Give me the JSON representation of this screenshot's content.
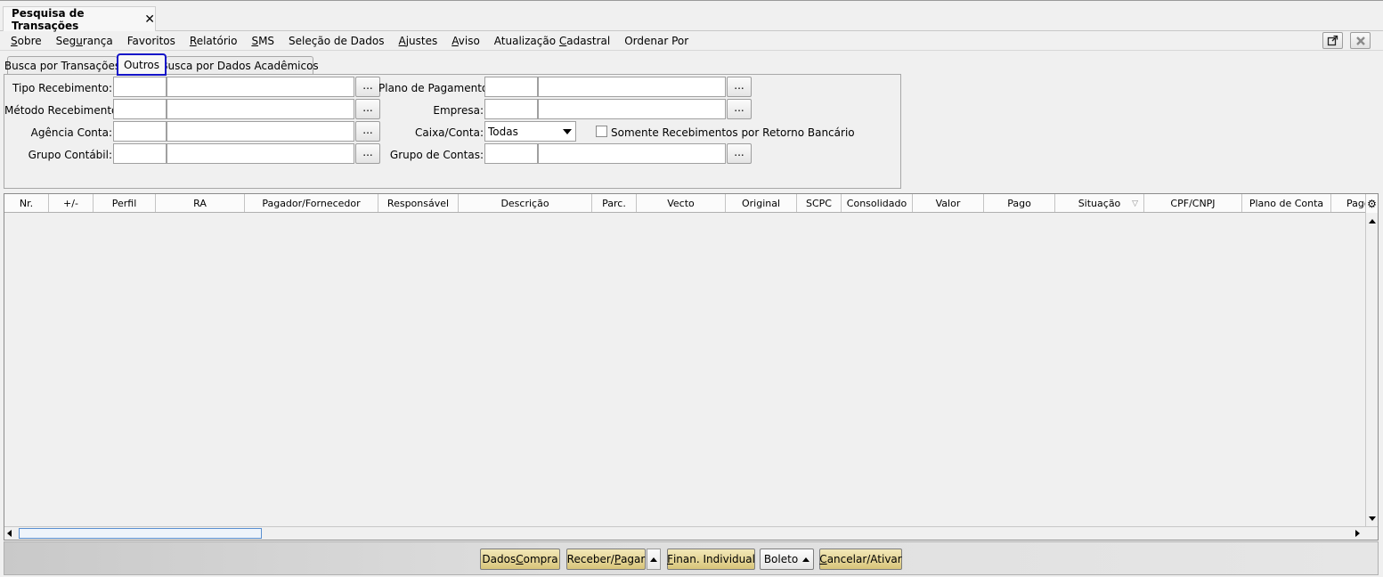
{
  "window_tab": {
    "title": "Pesquisa de Transações",
    "close": "✕"
  },
  "menu": [
    {
      "pre": "",
      "ul": "S",
      "post": "obre"
    },
    {
      "pre": "Seg",
      "ul": "u",
      "post": "rança"
    },
    {
      "pre": "Favoritos",
      "ul": "",
      "post": ""
    },
    {
      "pre": "",
      "ul": "R",
      "post": "elatório"
    },
    {
      "pre": "",
      "ul": "S",
      "post": "MS"
    },
    {
      "pre": "Seleção de Dados",
      "ul": "",
      "post": ""
    },
    {
      "pre": "",
      "ul": "A",
      "post": "justes"
    },
    {
      "pre": "",
      "ul": "A",
      "post": "viso"
    },
    {
      "pre": "Atualização ",
      "ul": "C",
      "post": "adastral"
    },
    {
      "pre": "Ordenar Por",
      "ul": "",
      "post": ""
    }
  ],
  "tabs": [
    {
      "label": "Busca por Transações"
    },
    {
      "label": "Outros"
    },
    {
      "label": "Busca por Dados Acadêmicos"
    }
  ],
  "filters": {
    "tipo_recebimento": "Tipo Recebimento:",
    "metodo_recebimento": "Método Recebimento:",
    "agencia_conta": "Agência Conta:",
    "grupo_contabil": "Grupo Contábil:",
    "plano_pagamento": "Plano de Pagamento:",
    "empresa": "Empresa:",
    "caixa_conta": "Caixa/Conta:",
    "caixa_conta_value": "Todas",
    "grupo_contas": "Grupo de Contas:",
    "somente_retorno": "Somente Recebimentos por Retorno Bancário",
    "lookup_button": "..."
  },
  "grid": {
    "columns": [
      "Nr.",
      "+/-",
      "Perfil",
      "RA",
      "Pagador/Fornecedor",
      "Responsável",
      "Descrição",
      "Parc.",
      "Vecto",
      "Original",
      "SCPC",
      "Consolidado",
      "Valor",
      "Pago",
      "Situação",
      "CPF/CNPJ",
      "Plano de Conta",
      "Pago"
    ],
    "rows": []
  },
  "actions": {
    "dados_compra": {
      "pre": "Dados ",
      "ul": "C",
      "post": "ompra"
    },
    "receber_pagar": {
      "pre": "Receber/",
      "ul": "P",
      "post": "agar"
    },
    "finan_individual": {
      "pre": "",
      "ul": "F",
      "post": "inan. Individual"
    },
    "boleto": "Boleto",
    "cancelar_ativar": {
      "pre": "",
      "ul": "C",
      "post": "ancelar/Ativar"
    }
  },
  "icons": {
    "close": "close-icon",
    "gear": "gear-icon",
    "popout": "popout-icon",
    "filter": "filter-icon"
  },
  "colors": {
    "focus_ring": "#1414c8",
    "action_button": "#e2d08f",
    "scroll_thumb_border": "#5a8fd0"
  }
}
